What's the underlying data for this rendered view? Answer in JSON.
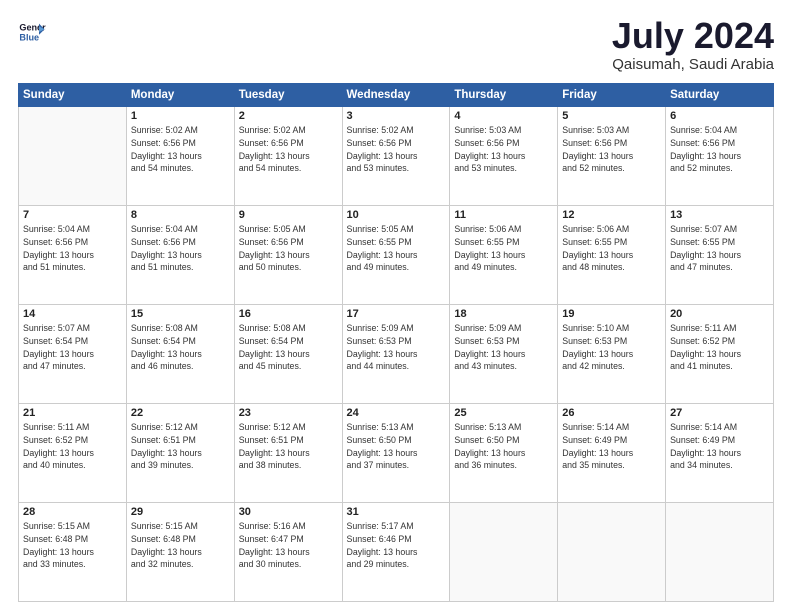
{
  "header": {
    "logo_line1": "General",
    "logo_line2": "Blue",
    "title": "July 2024",
    "subtitle": "Qaisumah, Saudi Arabia"
  },
  "weekdays": [
    "Sunday",
    "Monday",
    "Tuesday",
    "Wednesday",
    "Thursday",
    "Friday",
    "Saturday"
  ],
  "weeks": [
    [
      {
        "day": "",
        "info": ""
      },
      {
        "day": "1",
        "info": "Sunrise: 5:02 AM\nSunset: 6:56 PM\nDaylight: 13 hours\nand 54 minutes."
      },
      {
        "day": "2",
        "info": "Sunrise: 5:02 AM\nSunset: 6:56 PM\nDaylight: 13 hours\nand 54 minutes."
      },
      {
        "day": "3",
        "info": "Sunrise: 5:02 AM\nSunset: 6:56 PM\nDaylight: 13 hours\nand 53 minutes."
      },
      {
        "day": "4",
        "info": "Sunrise: 5:03 AM\nSunset: 6:56 PM\nDaylight: 13 hours\nand 53 minutes."
      },
      {
        "day": "5",
        "info": "Sunrise: 5:03 AM\nSunset: 6:56 PM\nDaylight: 13 hours\nand 52 minutes."
      },
      {
        "day": "6",
        "info": "Sunrise: 5:04 AM\nSunset: 6:56 PM\nDaylight: 13 hours\nand 52 minutes."
      }
    ],
    [
      {
        "day": "7",
        "info": "Sunrise: 5:04 AM\nSunset: 6:56 PM\nDaylight: 13 hours\nand 51 minutes."
      },
      {
        "day": "8",
        "info": "Sunrise: 5:04 AM\nSunset: 6:56 PM\nDaylight: 13 hours\nand 51 minutes."
      },
      {
        "day": "9",
        "info": "Sunrise: 5:05 AM\nSunset: 6:56 PM\nDaylight: 13 hours\nand 50 minutes."
      },
      {
        "day": "10",
        "info": "Sunrise: 5:05 AM\nSunset: 6:55 PM\nDaylight: 13 hours\nand 49 minutes."
      },
      {
        "day": "11",
        "info": "Sunrise: 5:06 AM\nSunset: 6:55 PM\nDaylight: 13 hours\nand 49 minutes."
      },
      {
        "day": "12",
        "info": "Sunrise: 5:06 AM\nSunset: 6:55 PM\nDaylight: 13 hours\nand 48 minutes."
      },
      {
        "day": "13",
        "info": "Sunrise: 5:07 AM\nSunset: 6:55 PM\nDaylight: 13 hours\nand 47 minutes."
      }
    ],
    [
      {
        "day": "14",
        "info": "Sunrise: 5:07 AM\nSunset: 6:54 PM\nDaylight: 13 hours\nand 47 minutes."
      },
      {
        "day": "15",
        "info": "Sunrise: 5:08 AM\nSunset: 6:54 PM\nDaylight: 13 hours\nand 46 minutes."
      },
      {
        "day": "16",
        "info": "Sunrise: 5:08 AM\nSunset: 6:54 PM\nDaylight: 13 hours\nand 45 minutes."
      },
      {
        "day": "17",
        "info": "Sunrise: 5:09 AM\nSunset: 6:53 PM\nDaylight: 13 hours\nand 44 minutes."
      },
      {
        "day": "18",
        "info": "Sunrise: 5:09 AM\nSunset: 6:53 PM\nDaylight: 13 hours\nand 43 minutes."
      },
      {
        "day": "19",
        "info": "Sunrise: 5:10 AM\nSunset: 6:53 PM\nDaylight: 13 hours\nand 42 minutes."
      },
      {
        "day": "20",
        "info": "Sunrise: 5:11 AM\nSunset: 6:52 PM\nDaylight: 13 hours\nand 41 minutes."
      }
    ],
    [
      {
        "day": "21",
        "info": "Sunrise: 5:11 AM\nSunset: 6:52 PM\nDaylight: 13 hours\nand 40 minutes."
      },
      {
        "day": "22",
        "info": "Sunrise: 5:12 AM\nSunset: 6:51 PM\nDaylight: 13 hours\nand 39 minutes."
      },
      {
        "day": "23",
        "info": "Sunrise: 5:12 AM\nSunset: 6:51 PM\nDaylight: 13 hours\nand 38 minutes."
      },
      {
        "day": "24",
        "info": "Sunrise: 5:13 AM\nSunset: 6:50 PM\nDaylight: 13 hours\nand 37 minutes."
      },
      {
        "day": "25",
        "info": "Sunrise: 5:13 AM\nSunset: 6:50 PM\nDaylight: 13 hours\nand 36 minutes."
      },
      {
        "day": "26",
        "info": "Sunrise: 5:14 AM\nSunset: 6:49 PM\nDaylight: 13 hours\nand 35 minutes."
      },
      {
        "day": "27",
        "info": "Sunrise: 5:14 AM\nSunset: 6:49 PM\nDaylight: 13 hours\nand 34 minutes."
      }
    ],
    [
      {
        "day": "28",
        "info": "Sunrise: 5:15 AM\nSunset: 6:48 PM\nDaylight: 13 hours\nand 33 minutes."
      },
      {
        "day": "29",
        "info": "Sunrise: 5:15 AM\nSunset: 6:48 PM\nDaylight: 13 hours\nand 32 minutes."
      },
      {
        "day": "30",
        "info": "Sunrise: 5:16 AM\nSunset: 6:47 PM\nDaylight: 13 hours\nand 30 minutes."
      },
      {
        "day": "31",
        "info": "Sunrise: 5:17 AM\nSunset: 6:46 PM\nDaylight: 13 hours\nand 29 minutes."
      },
      {
        "day": "",
        "info": ""
      },
      {
        "day": "",
        "info": ""
      },
      {
        "day": "",
        "info": ""
      }
    ]
  ]
}
